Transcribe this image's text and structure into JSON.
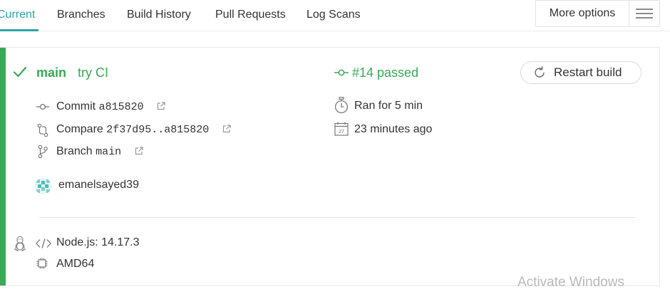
{
  "tabs": [
    {
      "label": "Current",
      "active": true
    },
    {
      "label": "Branches",
      "active": false
    },
    {
      "label": "Build History",
      "active": false
    },
    {
      "label": "Pull Requests",
      "active": false
    },
    {
      "label": "Log Scans",
      "active": false
    }
  ],
  "more_options": {
    "label": "More options",
    "icon": "hamburger-menu-icon"
  },
  "colors": {
    "accent": "#2fa3a8",
    "passed": "#39aa56",
    "divider": "#e6e6e6"
  },
  "build": {
    "branch": "main",
    "message": "try CI",
    "status_text": "#14 passed",
    "restart_label": "Restart build",
    "commit": {
      "label": "Commit",
      "value": "a815820"
    },
    "compare": {
      "label": "Compare",
      "value": "2f37d95..a815820"
    },
    "branch_ref": {
      "label": "Branch",
      "value": "main"
    },
    "author": "emanelsayed39",
    "duration": "Ran for 5 min",
    "finished": "23 minutes ago",
    "calendar_day": "27",
    "language": "Node.js: 14.17.3",
    "arch": "AMD64",
    "icons": [
      "check-icon",
      "commit-icon",
      "compare-icon",
      "branch-icon",
      "timer-icon",
      "calendar-icon",
      "linux-icon",
      "code-icon",
      "chip-icon",
      "restart-icon",
      "external-link-icon"
    ]
  },
  "watermark": "Activate Windows"
}
